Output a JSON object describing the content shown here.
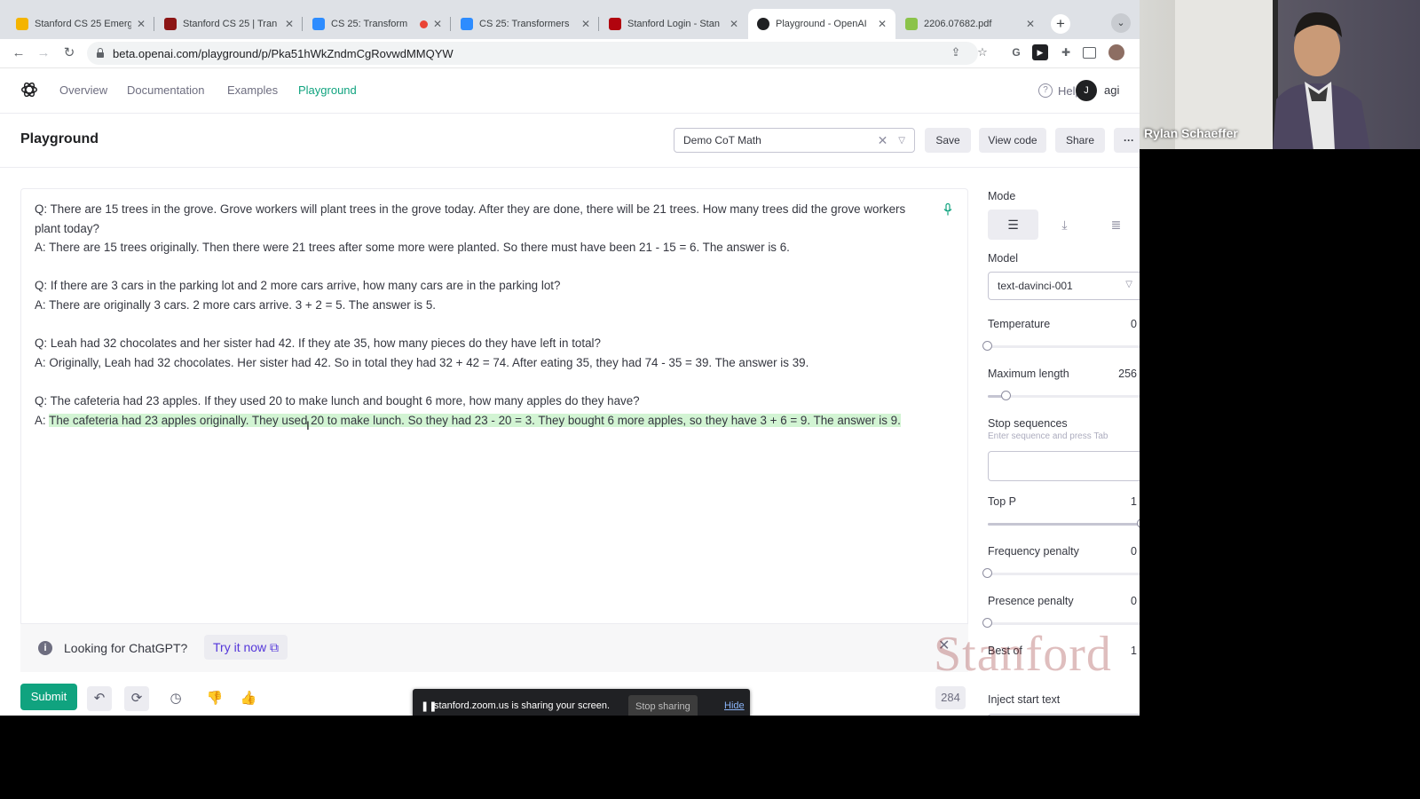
{
  "browser": {
    "tabs": [
      {
        "title": "Stanford CS 25 Emerg",
        "favicon_color": "#f4b400",
        "active": false
      },
      {
        "title": "Stanford CS 25 | Tran",
        "favicon_color": "#8c1515",
        "active": false
      },
      {
        "title": "CS 25: Transform",
        "favicon_color": "#2d8cff",
        "active": false,
        "recording": true
      },
      {
        "title": "CS 25: Transformers",
        "favicon_color": "#2d8cff",
        "active": false
      },
      {
        "title": "Stanford Login - Stan",
        "favicon_color": "#b1040e",
        "active": false
      },
      {
        "title": "Playground - OpenAI",
        "favicon_color": "#202123",
        "active": true
      },
      {
        "title": "2206.07682.pdf",
        "favicon_color": "#8bc34a",
        "active": false
      }
    ],
    "url": "beta.openai.com/playground/p/Pka51hWkZndmCgRovwdMMQYW"
  },
  "nav": {
    "links": [
      "Overview",
      "Documentation",
      "Examples",
      "Playground"
    ],
    "active": "Playground",
    "help": "Help",
    "avatar_initial": "J",
    "org": "agi"
  },
  "header": {
    "title": "Playground",
    "preset": "Demo CoT Math",
    "buttons": [
      "Save",
      "View code",
      "Share",
      "···"
    ]
  },
  "prompt": {
    "lines": [
      "Q: There are 15 trees in the grove. Grove workers will plant trees in the grove today. After they are done, there will be 21 trees. How many trees did the grove workers plant today?",
      "A: There are 15 trees originally. Then there were 21 trees after some more were planted. So there must have been 21 - 15 = 6. The answer is 6.",
      "",
      "Q: If there are 3 cars in the parking lot and 2 more cars arrive, how many cars are in the parking lot?",
      "A: There are originally 3 cars. 2 more cars arrive. 3 + 2 = 5. The answer is 5.",
      "",
      "Q: Leah had 32 chocolates and her sister had 42. If they ate 35, how many pieces do they have left in total?",
      "A: Originally, Leah had 32 chocolates. Her sister had 42. So in total they had 32 + 42 = 74. After eating 35, they had 74 - 35 = 39. The answer is 39.",
      "",
      "Q: The cafeteria had 23 apples. If they used 20 to make lunch and bought 6 more, how many apples do they have?"
    ],
    "completion_prefix": "A: ",
    "completion": "The cafeteria had 23 apples originally. They used 20 to make lunch. So they had 23 - 20 = 3. They bought 6 more apples, so they have 3 + 6 = 9. The answer is 9."
  },
  "banner": {
    "text": "Looking for ChatGPT?",
    "link": "Try it now"
  },
  "footer": {
    "submit": "Submit",
    "token_count": "284"
  },
  "zoom": {
    "message": "stanford.zoom.us is sharing your screen.",
    "stop": "Stop sharing",
    "hide": "Hide"
  },
  "settings": {
    "mode_label": "Mode",
    "model_label": "Model",
    "model": "text-davinci-001",
    "temperature": {
      "label": "Temperature",
      "value": "0",
      "fraction": 0.0
    },
    "max_length": {
      "label": "Maximum length",
      "value": "256",
      "fraction": 0.12
    },
    "stop_sequences": {
      "label": "Stop sequences",
      "hint": "Enter sequence and press Tab"
    },
    "top_p": {
      "label": "Top P",
      "value": "1",
      "fraction": 1.0
    },
    "frequency_penalty": {
      "label": "Frequency penalty",
      "value": "0",
      "fraction": 0.0
    },
    "presence_penalty": {
      "label": "Presence penalty",
      "value": "0",
      "fraction": 0.0
    },
    "best_of": {
      "label": "Best of",
      "value": "1"
    },
    "inject_start": {
      "label": "Inject start text",
      "checked": true
    }
  },
  "watermark": "Stanford",
  "webcam": {
    "name": "Rylan Schaeffer"
  }
}
